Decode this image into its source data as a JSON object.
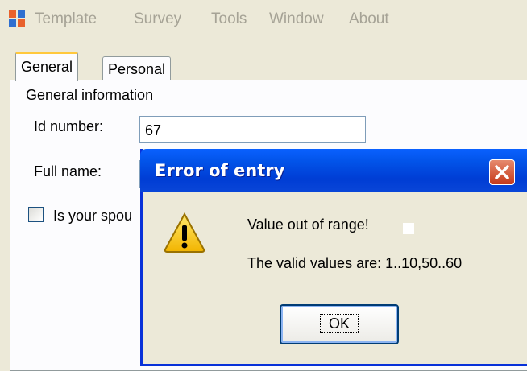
{
  "menu": {
    "items": [
      "Template",
      "Survey",
      "Tools",
      "Window",
      "About"
    ]
  },
  "tabs": [
    {
      "label": "General",
      "active": true
    },
    {
      "label": "Personal",
      "active": false
    }
  ],
  "form": {
    "group_title": "General information",
    "id_label": "Id number:",
    "id_value": "67",
    "fullname_label": "Full name:",
    "fullname_value": "",
    "spouse_label": "Is your spou"
  },
  "dialog": {
    "title": "Error of entry",
    "message1": "Value out of range!",
    "message2": "The valid values are: 1..10,50..60",
    "ok_label": "OK",
    "close_icon": "close-icon",
    "warning_icon": "warning-icon"
  },
  "colors": {
    "titlebar": "#0253e8",
    "close": "#c6391a",
    "tab_highlight": "#ffc83c"
  }
}
